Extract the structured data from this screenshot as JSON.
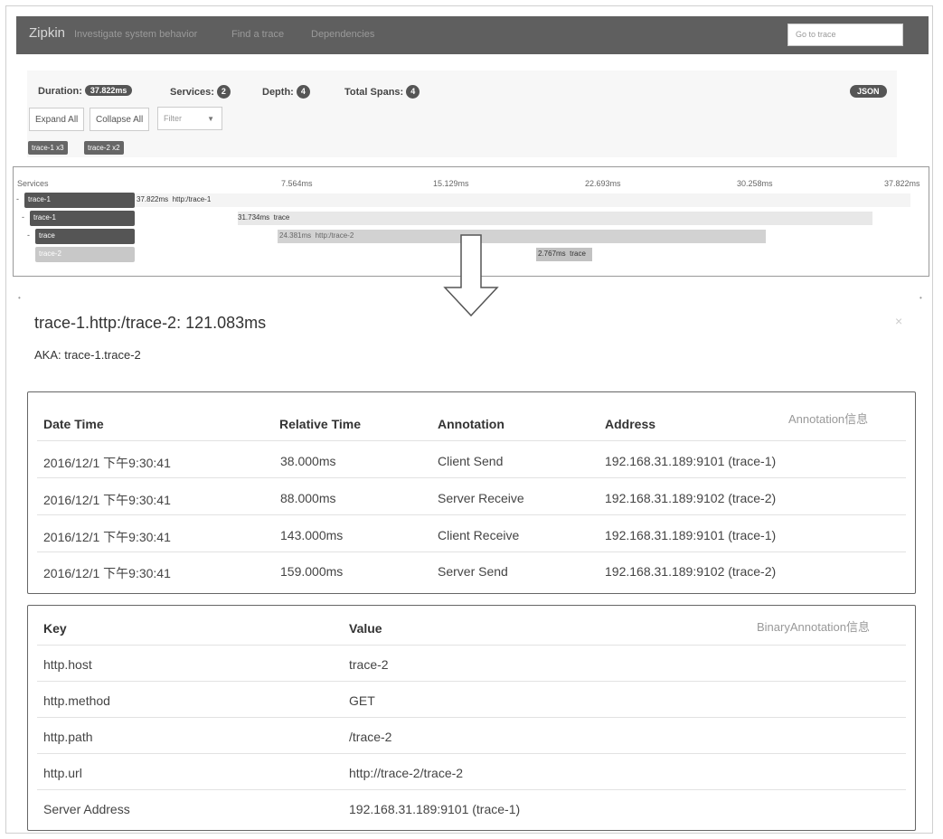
{
  "navbar": {
    "brand": "Zipkin",
    "tagline": "Investigate system behavior",
    "links": [
      "Find a trace",
      "Dependencies"
    ],
    "goto_placeholder": "Go to trace"
  },
  "summary": {
    "duration_label": "Duration:",
    "duration_value": "37.822ms",
    "services_label": "Services:",
    "services_value": "2",
    "depth_label": "Depth:",
    "depth_value": "4",
    "total_spans_label": "Total Spans:",
    "total_spans_value": "4",
    "json_button": "JSON",
    "expand_all": "Expand All",
    "collapse_all": "Collapse All",
    "filter_placeholder": "Filter",
    "service_tags": [
      "trace-1 x3",
      "trace-2 x2"
    ]
  },
  "timeline": {
    "services_header": "Services",
    "ticks": [
      "7.564ms",
      "15.129ms",
      "22.693ms",
      "30.258ms",
      "37.822ms"
    ],
    "rows": [
      {
        "service": "trace-1",
        "expander": "-",
        "duration": "37.822ms",
        "name": "http:/trace-1"
      },
      {
        "service": "trace-1",
        "expander": "-",
        "duration": "31.734ms",
        "name": "trace"
      },
      {
        "service": "trace",
        "expander": "-",
        "duration": "24.381ms",
        "name": "http:/trace-2"
      },
      {
        "service": "trace-2",
        "expander": "",
        "duration": "2.767ms",
        "name": "trace"
      }
    ]
  },
  "detail": {
    "title": "trace-1.http:/trace-2: 121.083ms",
    "aka": "AKA: trace-1.trace-2",
    "close": "×"
  },
  "annotations": {
    "tag": "Annotation信息",
    "headers": [
      "Date Time",
      "Relative Time",
      "Annotation",
      "Address"
    ],
    "rows": [
      [
        "2016/12/1 下午9:30:41",
        "38.000ms",
        "Client Send",
        "192.168.31.189:9101 (trace-1)"
      ],
      [
        "2016/12/1 下午9:30:41",
        "88.000ms",
        "Server Receive",
        "192.168.31.189:9102 (trace-2)"
      ],
      [
        "2016/12/1 下午9:30:41",
        "143.000ms",
        "Client Receive",
        "192.168.31.189:9101 (trace-1)"
      ],
      [
        "2016/12/1 下午9:30:41",
        "159.000ms",
        "Server Send",
        "192.168.31.189:9102 (trace-2)"
      ]
    ]
  },
  "binary_annotations": {
    "tag": "BinaryAnnotation信息",
    "headers": [
      "Key",
      "Value"
    ],
    "rows": [
      [
        "http.host",
        "trace-2"
      ],
      [
        "http.method",
        "GET"
      ],
      [
        "http.path",
        "/trace-2"
      ],
      [
        "http.url",
        "http://trace-2/trace-2"
      ],
      [
        "Server Address",
        "192.168.31.189:9101 (trace-1)"
      ]
    ]
  }
}
